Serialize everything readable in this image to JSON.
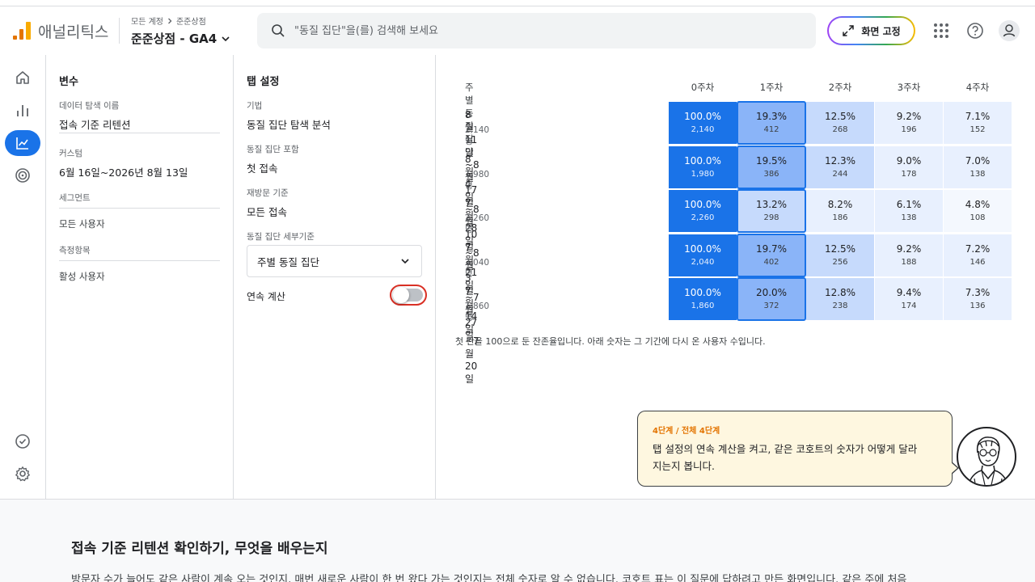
{
  "header": {
    "product_name": "애널리틱스",
    "breadcrumb": [
      "모든 계정",
      "준준상점"
    ],
    "property_name": "준준상점 - GA4",
    "search_placeholder": "\"동질 집단\"을(를) 검색해 보세요",
    "pin_button_label": "화면 고정"
  },
  "left_nav": {
    "items": [
      {
        "icon": "home-icon"
      },
      {
        "icon": "bar-chart-icon"
      },
      {
        "icon": "explore-icon",
        "active": true
      },
      {
        "icon": "target-icon"
      }
    ],
    "bottom_items": [
      {
        "icon": "check-circle-icon"
      },
      {
        "icon": "gear-icon"
      }
    ]
  },
  "variables": {
    "title": "변수",
    "exploration_label": "데이터 탐색 이름",
    "exploration_name": "접속 기준 리텐션",
    "custom_label": "커스텀",
    "date_range": "6월 16일~2026년 8월 13일",
    "segments_label": "세그먼트",
    "segment_item": "모든 사용자",
    "metrics_label": "측정항목",
    "metric_item": "활성 사용자"
  },
  "tab_settings": {
    "title": "탭 설정",
    "technique_label": "기법",
    "technique_value": "동질 집단 탐색 분석",
    "inclusion_label": "동질 집단 포함",
    "inclusion_value": "첫 접속",
    "return_label": "재방문 기준",
    "return_value": "모든 접속",
    "granularity_label": "동질 집단 세부기준",
    "granularity_value": "주별 동질 집단",
    "cumulative_label": "연속 계산",
    "cumulative_on": false
  },
  "chart_data": {
    "type": "table",
    "corner_header": "주별 동질 집단",
    "columns": [
      "0주차",
      "1주차",
      "2주차",
      "3주차",
      "4주차"
    ],
    "rows": [
      {
        "label": "8월 11일~8월 17일",
        "users": "2,140명",
        "cells": [
          {
            "pct": "100.0%",
            "count": "2,140"
          },
          {
            "pct": "19.3%",
            "count": "412"
          },
          {
            "pct": "12.5%",
            "count": "268"
          },
          {
            "pct": "9.2%",
            "count": "196"
          },
          {
            "pct": "7.1%",
            "count": "152"
          }
        ]
      },
      {
        "label": "8월 4일~8월 10일",
        "users": "1,980명",
        "cells": [
          {
            "pct": "100.0%",
            "count": "1,980"
          },
          {
            "pct": "19.5%",
            "count": "386"
          },
          {
            "pct": "12.3%",
            "count": "244"
          },
          {
            "pct": "9.0%",
            "count": "178"
          },
          {
            "pct": "7.0%",
            "count": "138"
          }
        ]
      },
      {
        "label": "7월 28일~8월 3일",
        "users": "2,260명",
        "cells": [
          {
            "pct": "100.0%",
            "count": "2,260"
          },
          {
            "pct": "13.2%",
            "count": "298"
          },
          {
            "pct": "8.2%",
            "count": "186"
          },
          {
            "pct": "6.1%",
            "count": "138"
          },
          {
            "pct": "4.8%",
            "count": "108"
          }
        ]
      },
      {
        "label": "7월 21일~7월 27일",
        "users": "2,040명",
        "cells": [
          {
            "pct": "100.0%",
            "count": "2,040"
          },
          {
            "pct": "19.7%",
            "count": "402"
          },
          {
            "pct": "12.5%",
            "count": "256"
          },
          {
            "pct": "9.2%",
            "count": "188"
          },
          {
            "pct": "7.2%",
            "count": "146"
          }
        ]
      },
      {
        "label": "7월 14일~7월 20일",
        "users": "1,860명",
        "cells": [
          {
            "pct": "100.0%",
            "count": "1,860"
          },
          {
            "pct": "20.0%",
            "count": "372"
          },
          {
            "pct": "12.8%",
            "count": "238"
          },
          {
            "pct": "9.4%",
            "count": "174"
          },
          {
            "pct": "7.3%",
            "count": "136"
          }
        ]
      }
    ],
    "highlighted_column": "1주차"
  },
  "table_note": "첫 칸을 100으로 둔 잔존율입니다. 아래 숫자는 그 기간에 다시 온 사용자 수입니다.",
  "tip": {
    "step": "4단계 / 전체 4단계",
    "message": "탭 설정의 연속 계산을 켜고, 같은 코호트의 숫자가 어떻게 달라지는지 봅니다."
  },
  "article": {
    "title": "접속 기준 리텐션 확인하기, 무엇을 배우는지",
    "body": "방문자 수가 늘어도 같은 사람이 계속 오는 것인지, 매번 새로운 사람이 한 번 왔다 가는 것인지는 전체 숫자로 알 수 없습니다. 코호트 표는 이 질문에 답하려고 만든 화면입니다. 같은 주에 처음"
  },
  "colors": {
    "accent": "#1a73e8",
    "cell_full": "#1a73e8",
    "cell_dark": "#8ab4f8",
    "cell_mid": "#c6dafc",
    "cell_light": "#e8f0fe",
    "cell_lightest": "#f4f8fe",
    "toggle_focus": "#d93025",
    "tip_bg": "#fef7e0",
    "tip_step": "#e37400"
  }
}
